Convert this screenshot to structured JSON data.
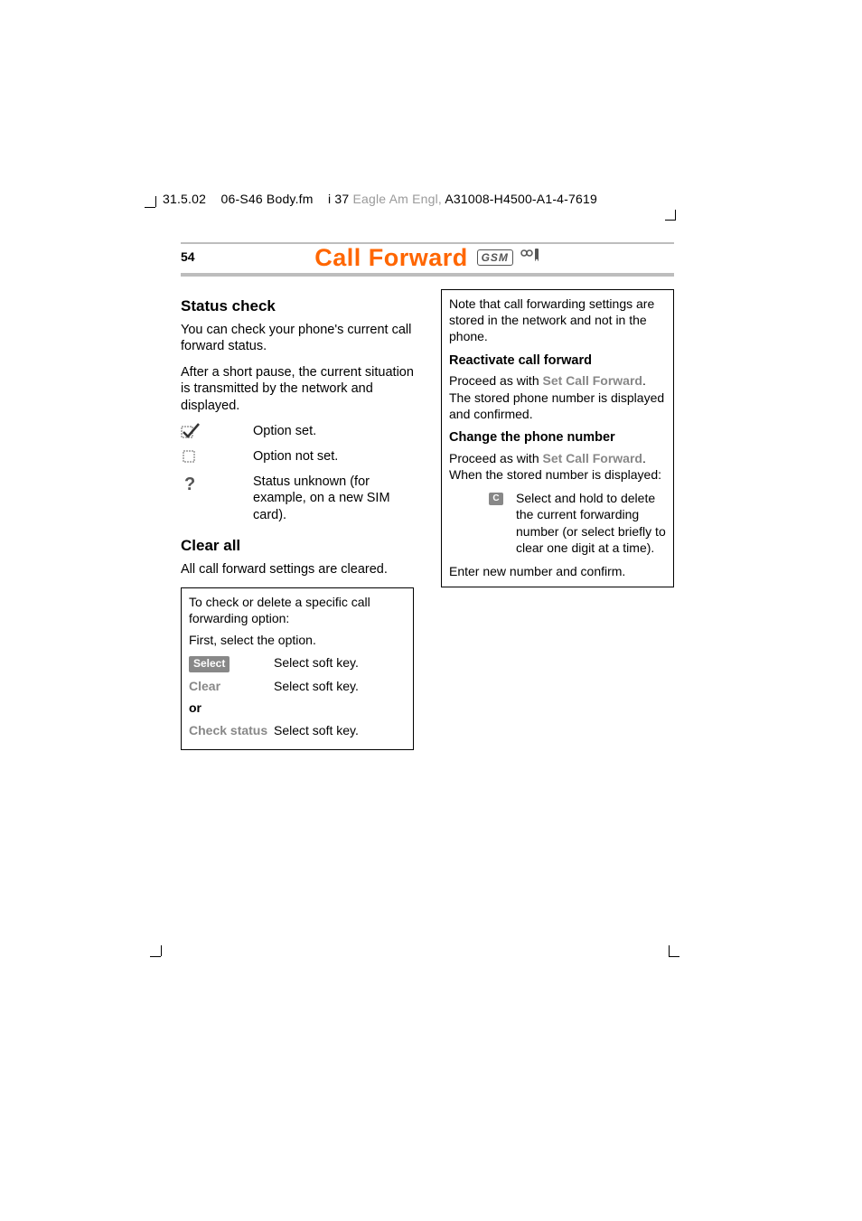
{
  "header": {
    "date": "31.5.02",
    "file": "06-S46 Body.fm",
    "index": "i 37",
    "product": "Eagle",
    "lang": "Am Engl,",
    "code": "A31008-H4500-A1-4-7619"
  },
  "page": {
    "number": "54",
    "title": "Call Forward",
    "gsm": "GSM"
  },
  "left": {
    "h_status": "Status check",
    "p1": "You can check your phone's current call forward status.",
    "p2": "After a short pause, the current situation is transmitted by the network and displayed.",
    "icons": [
      {
        "label": "Option set."
      },
      {
        "label": "Option not set."
      },
      {
        "label": "Status unknown (for example, on a new SIM card)."
      }
    ],
    "h_clear": "Clear all",
    "p3": "All call forward settings are cleared.",
    "box": {
      "intro": "To check or delete a specific call forwarding option:",
      "first": "First, select the option.",
      "select_key": "Select",
      "select_act": "Select soft key.",
      "clear_key": "Clear",
      "clear_act": "Select soft key.",
      "or": "or",
      "check_key": "Check status",
      "check_act": "Select soft key."
    }
  },
  "right": {
    "note": "Note that call forwarding settings are stored in the network and not in the phone.",
    "h_react": "Reactivate call forward",
    "react_pre": "Proceed as with ",
    "react_link": "Set Call Forward",
    "react_post": ". The stored phone number is displayed and confirmed.",
    "h_change": "Change the phone number",
    "change_pre": "Proceed as with ",
    "change_link": "Set Call Forward",
    "change_post": ". When the stored number is displayed:",
    "c_key": "C",
    "c_text": "Select and hold to delete the current forwarding number (or select briefly to clear one digit at a time).",
    "enter": "Enter new number and confirm."
  }
}
